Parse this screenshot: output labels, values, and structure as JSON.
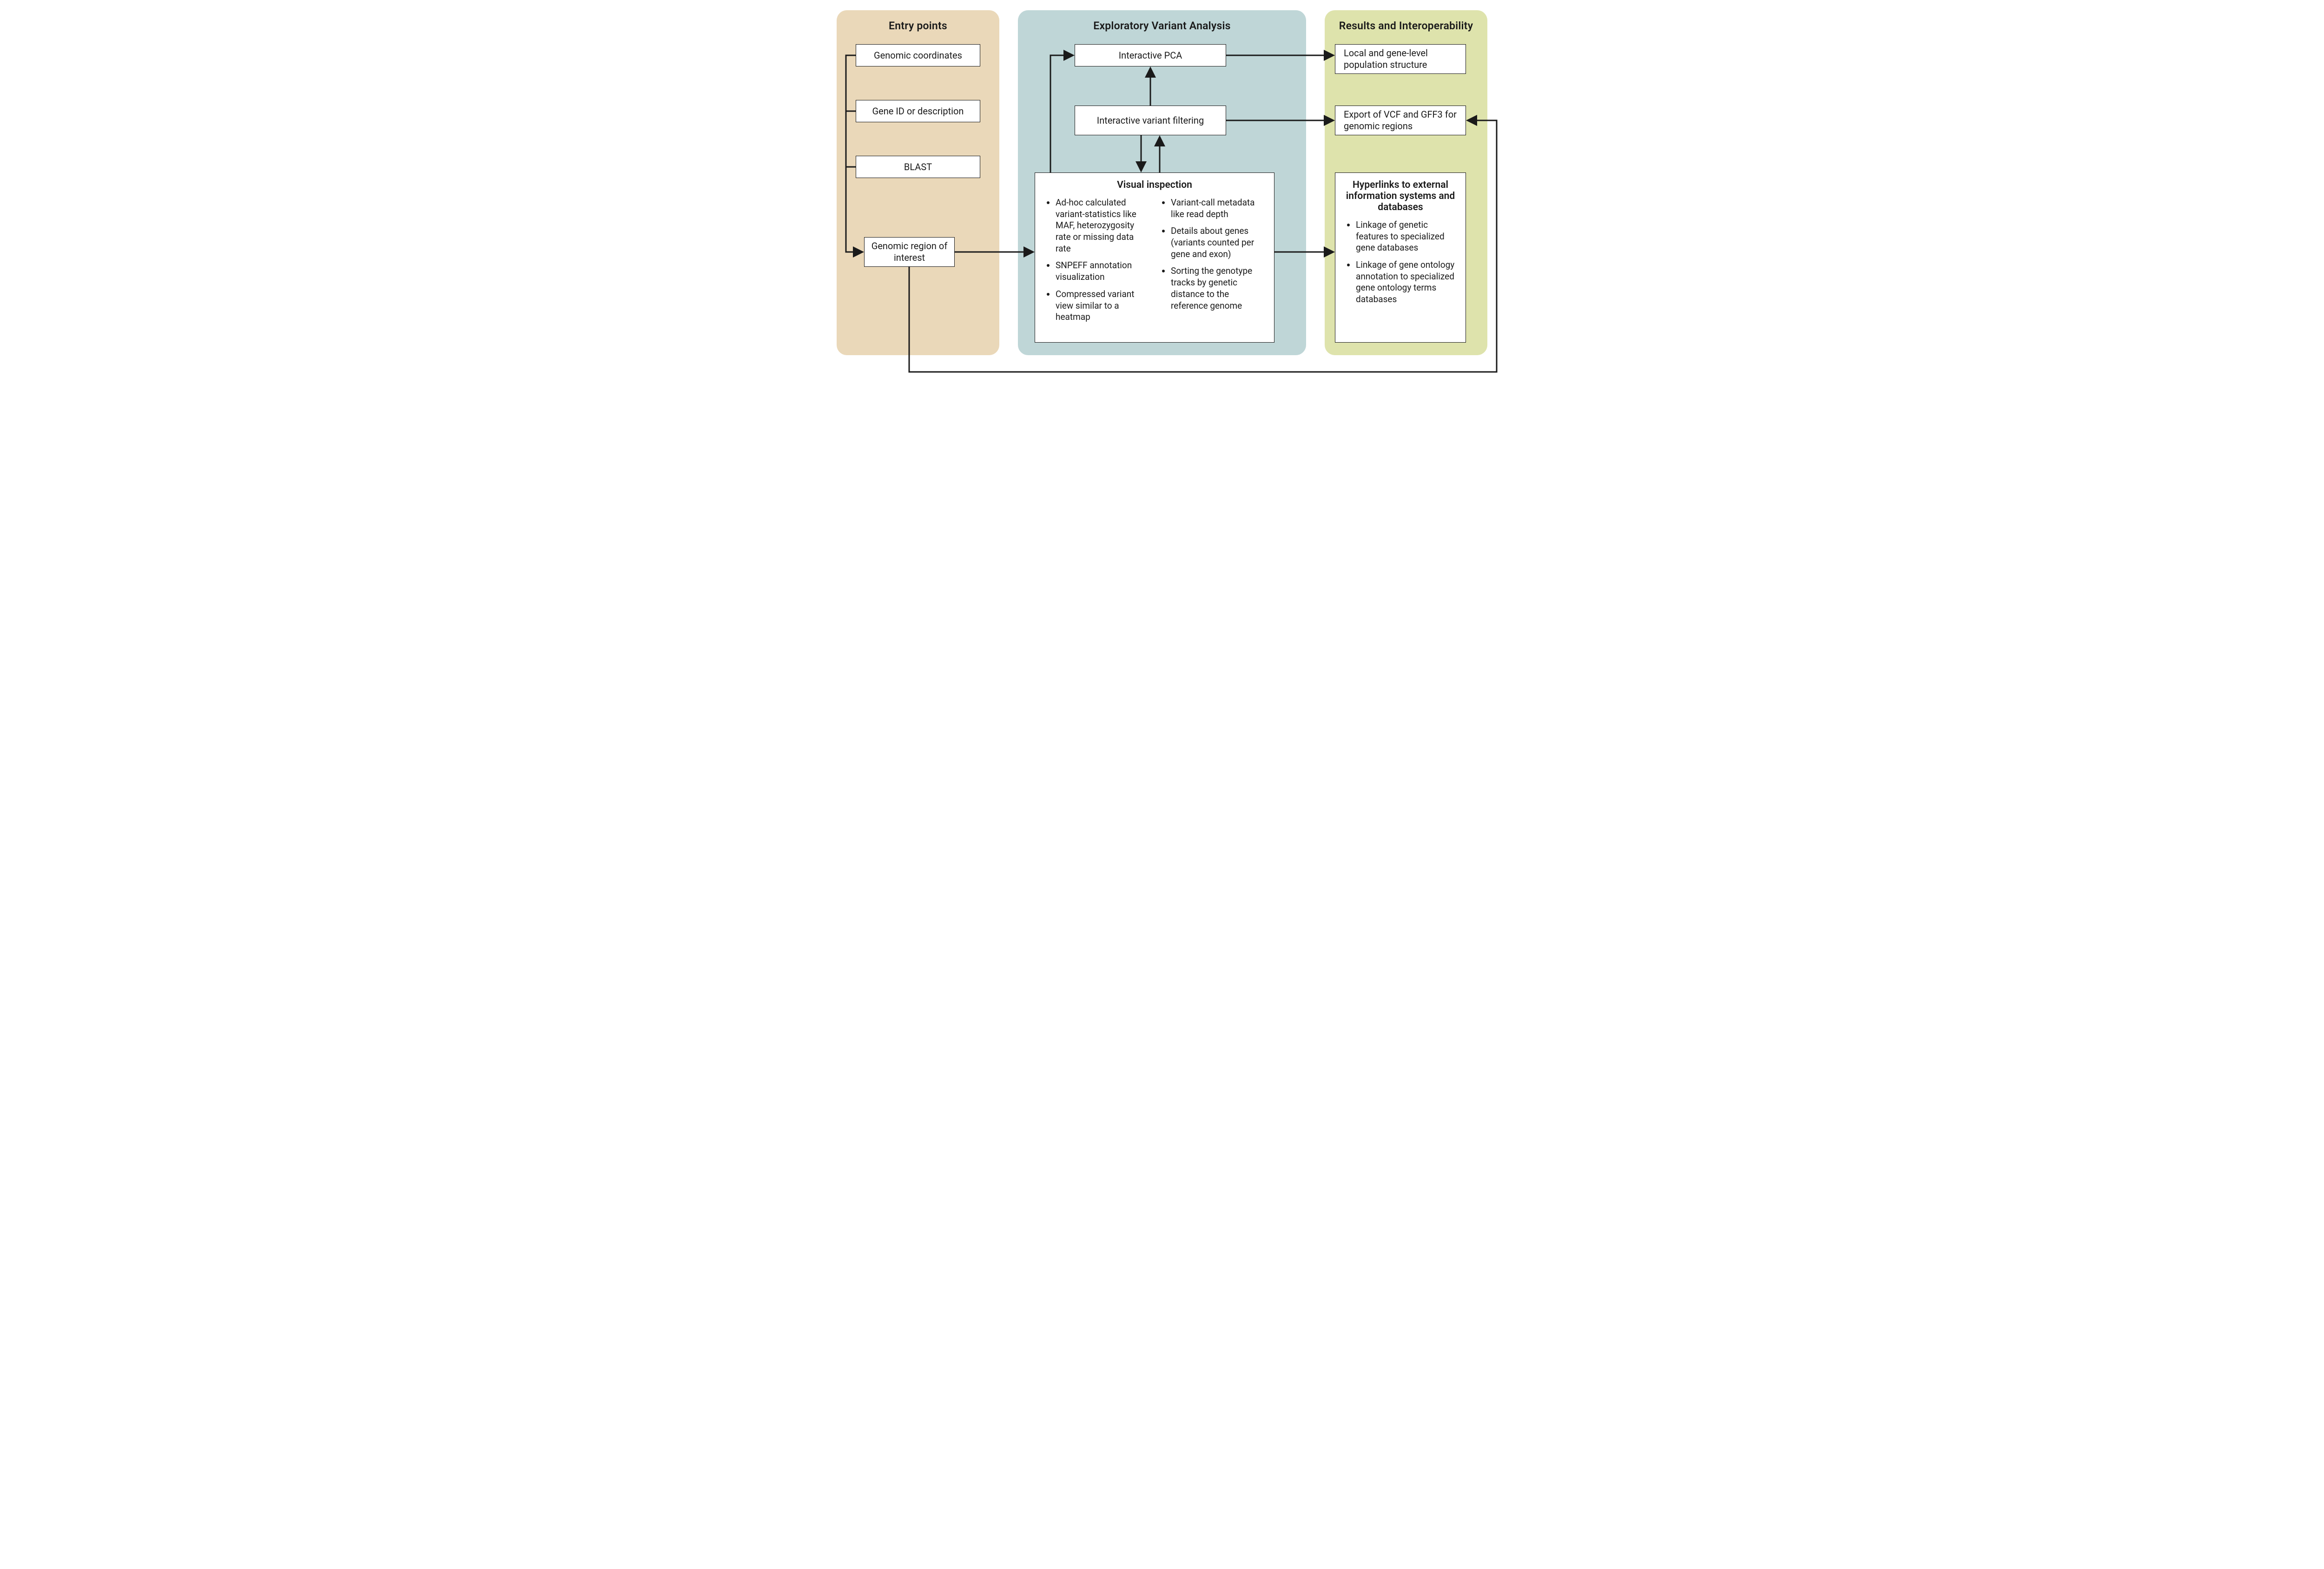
{
  "columns": {
    "entry": {
      "title": "Entry points",
      "bg": "#ead8b9"
    },
    "analysis": {
      "title": "Exploratory Variant Analysis",
      "bg": "#bfd6d7"
    },
    "results": {
      "title": "Results and Interoperability",
      "bg": "#dee3ac"
    }
  },
  "entry": {
    "coords": "Genomic coordinates",
    "gene_id": "Gene ID or description",
    "blast": "BLAST",
    "region": "Genomic region of interest"
  },
  "analysis": {
    "pca": "Interactive PCA",
    "filter": "Interactive variant filtering",
    "visual_title": "Visual inspection",
    "visual_left": [
      "Ad-hoc calculated variant-statistics like MAF, heterozygosity rate or missing data rate",
      "SNPEFF annotation visualization",
      "Compressed variant view similar to a heatmap"
    ],
    "visual_right": [
      "Variant-call metadata like read depth",
      "Details about genes (variants counted per gene and exon)",
      "Sorting the genotype tracks by genetic distance to the reference genome"
    ]
  },
  "results": {
    "pop": "Local and gene-level population structure",
    "export": "Export of VCF and GFF3 for genomic regions",
    "hyper_title": "Hyperlinks to external information systems and databases",
    "hyper_items": [
      "Linkage of genetic features to specialized gene databases",
      "Linkage of gene ontology annotation to specialized gene ontology terms databases"
    ]
  }
}
